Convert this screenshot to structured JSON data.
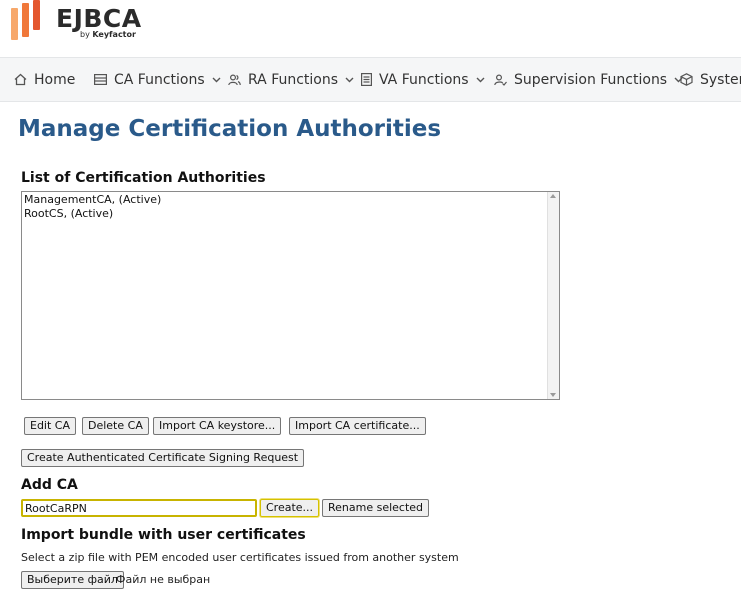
{
  "brand": {
    "name": "EJBCA",
    "tagline_prefix": "by",
    "tagline_company": "Keyfactor",
    "colors": [
      "#f7a86b",
      "#f0783a",
      "#e4572e"
    ]
  },
  "nav": {
    "items": [
      {
        "label": "Home",
        "icon": "home-icon",
        "has_dropdown": false
      },
      {
        "label": "CA Functions",
        "icon": "list-icon",
        "has_dropdown": true
      },
      {
        "label": "RA Functions",
        "icon": "users-icon",
        "has_dropdown": true
      },
      {
        "label": "VA Functions",
        "icon": "document-icon",
        "has_dropdown": true
      },
      {
        "label": "Supervision Functions",
        "icon": "user-check-icon",
        "has_dropdown": true
      },
      {
        "label": "System",
        "icon": "cube-icon",
        "has_dropdown": true
      }
    ]
  },
  "page": {
    "title": "Manage Certification Authorities",
    "list_heading": "List of Certification Authorities",
    "cas": [
      "ManagementCA, (Active)",
      "RootCS, (Active)"
    ],
    "buttons": {
      "edit": "Edit CA",
      "delete": "Delete CA",
      "import_keystore": "Import CA keystore...",
      "import_certificate": "Import CA certificate...",
      "csr": "Create Authenticated Certificate Signing Request"
    },
    "add_heading": "Add CA",
    "add_input_value": "RootCaRPN",
    "create_button": "Create...",
    "rename_button": "Rename selected",
    "import_heading": "Import bundle with user certificates",
    "import_description": "Select a zip file with PEM encoded user certificates issued from another system",
    "choose_file_button": "Выберите файл",
    "no_file_text": "Файл не выбран"
  }
}
